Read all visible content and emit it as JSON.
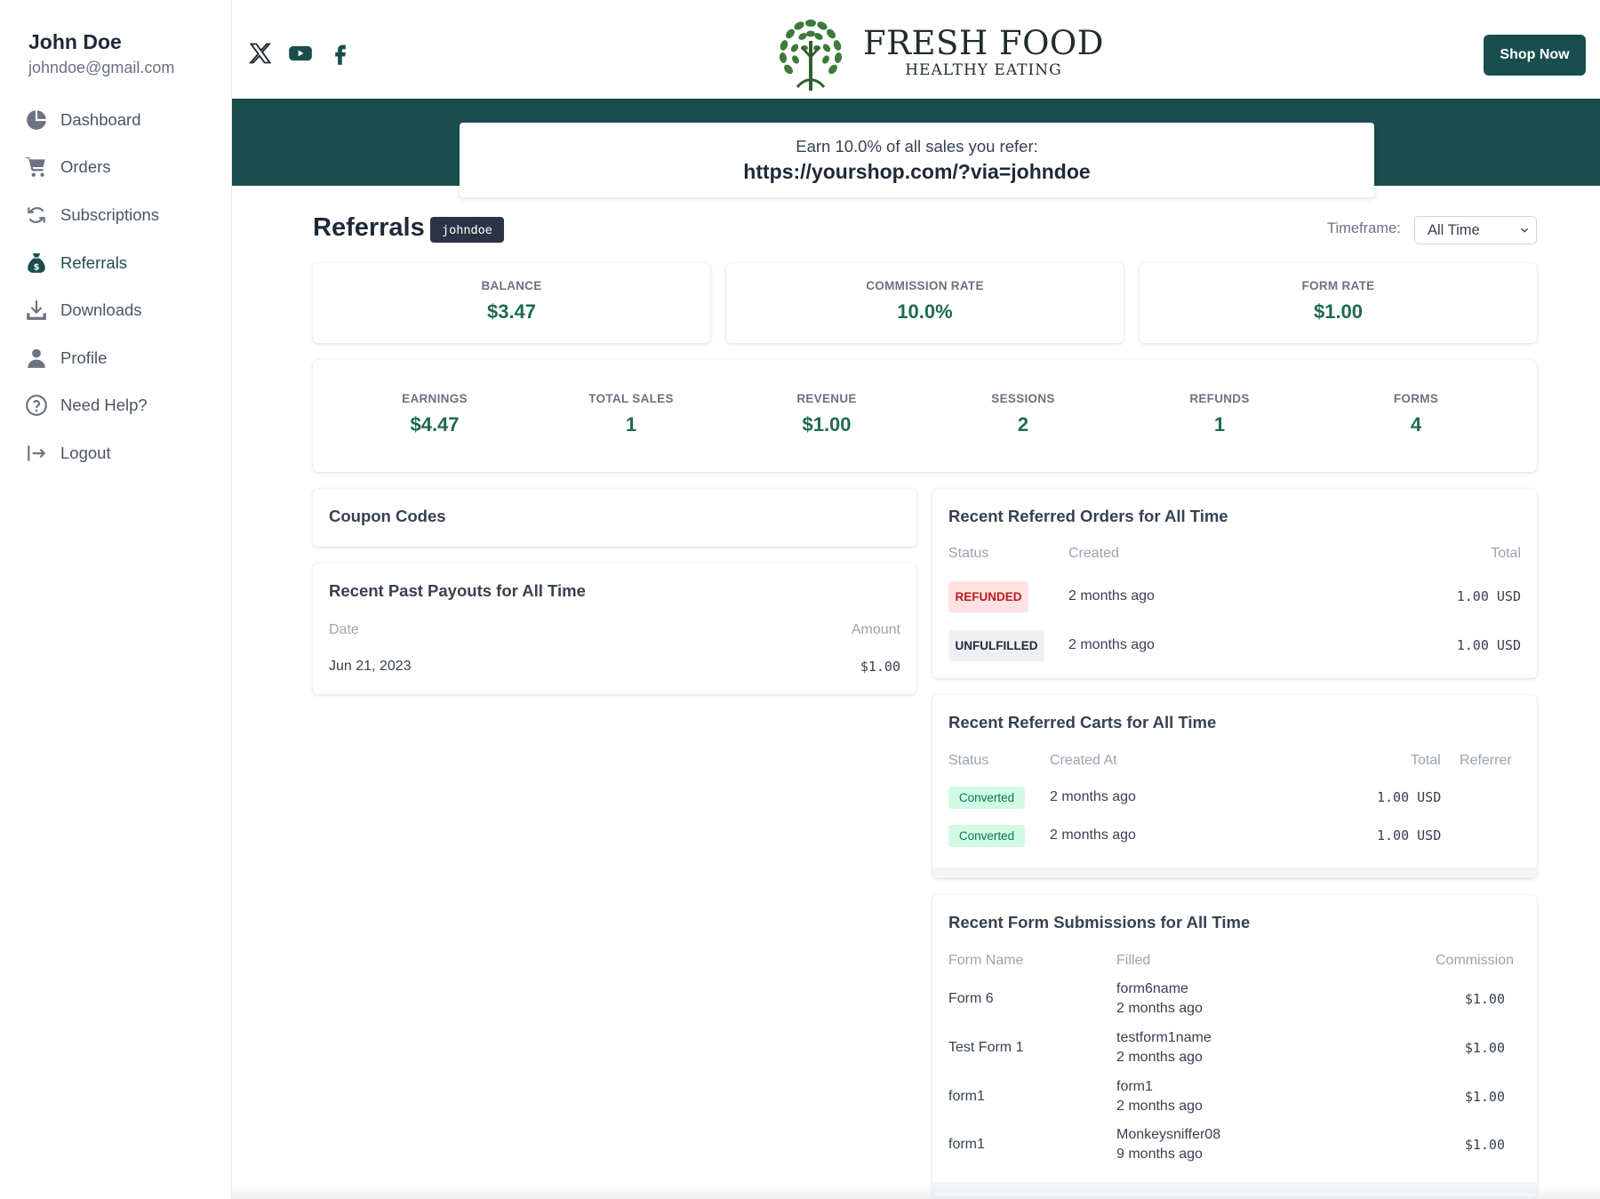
{
  "user": {
    "name": "John Doe",
    "email": "johndoe@gmail.com"
  },
  "sidebar": {
    "items": [
      {
        "label": "Dashboard",
        "icon": "pie-chart-icon"
      },
      {
        "label": "Orders",
        "icon": "cart-icon"
      },
      {
        "label": "Subscriptions",
        "icon": "refresh-icon"
      },
      {
        "label": "Referrals",
        "icon": "money-bag-icon",
        "active": true
      },
      {
        "label": "Downloads",
        "icon": "download-icon"
      },
      {
        "label": "Profile",
        "icon": "user-icon"
      },
      {
        "label": "Need Help?",
        "icon": "question-icon"
      },
      {
        "label": "Logout",
        "icon": "logout-icon"
      }
    ]
  },
  "header": {
    "social": [
      "x-twitter-icon",
      "youtube-icon",
      "facebook-icon"
    ],
    "logo": {
      "title": "FRESH FOOD",
      "subtitle": "HEALTHY EATING"
    },
    "shop_button": "Shop Now"
  },
  "referral_link": {
    "earn_text": "Earn 10.0% of all sales you refer:",
    "url": "https://yourshop.com/?via=johndoe"
  },
  "page": {
    "title": "Referrals",
    "code_badge": "johndoe",
    "timeframe_label": "Timeframe:",
    "timeframe_value": "All Time"
  },
  "summary": [
    {
      "label": "BALANCE",
      "value": "$3.47"
    },
    {
      "label": "COMMISSION RATE",
      "value": "10.0%"
    },
    {
      "label": "FORM RATE",
      "value": "$1.00"
    }
  ],
  "stats": [
    {
      "label": "EARNINGS",
      "value": "$4.47"
    },
    {
      "label": "TOTAL SALES",
      "value": "1"
    },
    {
      "label": "REVENUE",
      "value": "$1.00"
    },
    {
      "label": "SESSIONS",
      "value": "2"
    },
    {
      "label": "REFUNDS",
      "value": "1"
    },
    {
      "label": "FORMS",
      "value": "4"
    }
  ],
  "coupon_codes": {
    "title": "Coupon Codes"
  },
  "payouts": {
    "title": "Recent Past Payouts for All Time",
    "headers": [
      "Date",
      "Amount"
    ],
    "rows": [
      {
        "date": "Jun 21, 2023",
        "amount": "$1.00"
      }
    ]
  },
  "orders": {
    "title": "Recent Referred Orders for All Time",
    "headers": [
      "Status",
      "Created",
      "Total"
    ],
    "rows": [
      {
        "status": "REFUNDED",
        "created": "2 months ago",
        "total": "1.00 USD"
      },
      {
        "status": "UNFULFILLED",
        "created": "2 months ago",
        "total": "1.00 USD"
      }
    ]
  },
  "carts": {
    "title": "Recent Referred Carts for All Time",
    "headers": [
      "Status",
      "Created At",
      "Total",
      "Referrer"
    ],
    "rows": [
      {
        "status": "Converted",
        "created": "2 months ago",
        "total": "1.00 USD"
      },
      {
        "status": "Converted",
        "created": "2 months ago",
        "total": "1.00 USD"
      }
    ]
  },
  "forms": {
    "title": "Recent Form Submissions for All Time",
    "headers": [
      "Form Name",
      "Filled",
      "Commission"
    ],
    "rows": [
      {
        "name": "Form 6",
        "filled_name": "form6name",
        "filled_when": "2 months ago",
        "commission": "$1.00"
      },
      {
        "name": "Test Form 1",
        "filled_name": "testform1name",
        "filled_when": "2 months ago",
        "commission": "$1.00"
      },
      {
        "name": "form1",
        "filled_name": "form1",
        "filled_when": "2 months ago",
        "commission": "$1.00"
      },
      {
        "name": "form1",
        "filled_name": "Monkeysniffer08",
        "filled_when": "9 months ago",
        "commission": "$1.00"
      }
    ]
  },
  "colors": {
    "brand": "#1a4d4e",
    "value_green": "#1f6b4f",
    "refunded_bg": "#fee2e2",
    "refunded_text": "#b91c1c",
    "converted_bg": "#d1fae5",
    "converted_text": "#047857"
  }
}
